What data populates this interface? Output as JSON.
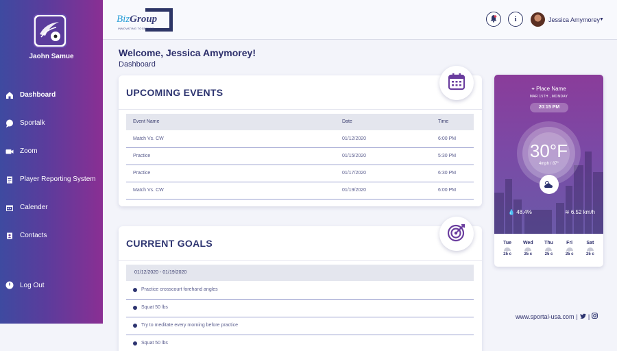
{
  "sidebar": {
    "user_name": "Jaohn Samue",
    "items": [
      {
        "label": "Dashboard",
        "icon": "home-icon"
      },
      {
        "label": "Sportalk",
        "icon": "chat-icon"
      },
      {
        "label": "Zoom",
        "icon": "video-icon"
      },
      {
        "label": "Player Reporting System",
        "icon": "clipboard-icon"
      },
      {
        "label": "Calender",
        "icon": "calendar-icon"
      },
      {
        "label": "Contacts",
        "icon": "contacts-icon"
      }
    ],
    "logout_label": "Log Out"
  },
  "header": {
    "brand_name_1": "Biz",
    "brand_name_2": "Group",
    "brand_tagline": "INNOVATING TOGETHER",
    "user_name": "Jessica Amymorey",
    "info_symbol": "i"
  },
  "welcome": {
    "title": "Welcome, Jessica Amymorey!",
    "subtitle": "Dashboard"
  },
  "events": {
    "title": "UPCOMING EVENTS",
    "columns": [
      "Event Name",
      "Date",
      "Time"
    ],
    "rows": [
      [
        "Match Vs. CW",
        "01/12/2020",
        "6:00 PM"
      ],
      [
        "Practice",
        "01/15/2020",
        "5:30 PM"
      ],
      [
        "Practice",
        "01/17/2020",
        "6:30 PM"
      ],
      [
        "Match Vs. CW",
        "01/19/2020",
        "6:00 PM"
      ]
    ]
  },
  "goals": {
    "title": "CURRENT GOALS",
    "range": "01/12/2020 - 01/19/2020",
    "items": [
      "Practice crosscourt forehand angles",
      "Squat 50 lbs",
      "Try to meditate every morning before practice",
      "Squat 50 lbs"
    ]
  },
  "weather": {
    "place": "Place Name",
    "date": "MAR 15TH , MONDAY",
    "time": "20:15 PM",
    "temperature": "30°F",
    "wind_small": "4mph / 87°",
    "humidity": "48.4%",
    "wind": "6.52 km/h",
    "forecast": [
      {
        "day": "Tue",
        "temp": "25 c"
      },
      {
        "day": "Wed",
        "temp": "25 c"
      },
      {
        "day": "Thu",
        "temp": "25 c"
      },
      {
        "day": "Fri",
        "temp": "25 c"
      },
      {
        "day": "Sat",
        "temp": "25 c"
      }
    ]
  },
  "footer": {
    "site": "www.sportal-usa.com",
    "sep1": "|",
    "sep2": "|"
  },
  "colors": {
    "sidebar_start": "#3e4aa0",
    "sidebar_end": "#8a2f93",
    "accent": "#2d3470"
  }
}
